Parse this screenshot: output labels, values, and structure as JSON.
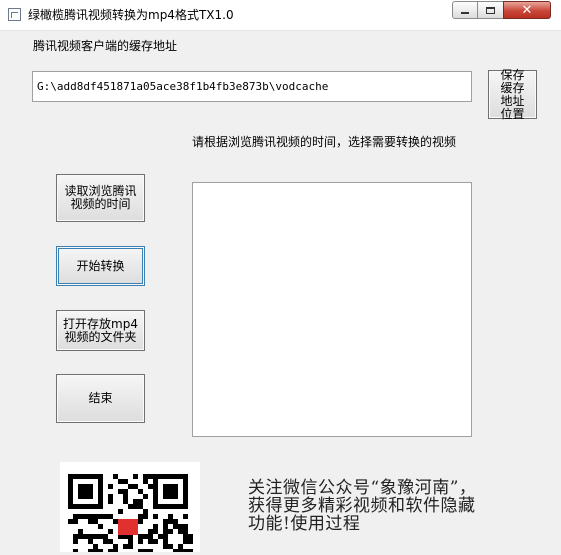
{
  "window": {
    "title": "绿橄榄腾讯视频转换为mp4格式TX1.0",
    "controls": {
      "minimize": "minimize-icon",
      "maximize": "maximize-icon",
      "close": "✕"
    }
  },
  "cache": {
    "label": "腾讯视频客户端的缓存地址",
    "path_value": "G:\\add8df451871a05ace38f1b4fb3e873b\\vodcache",
    "save_button": "保存缓存地址位置"
  },
  "instruction": "请根据浏览腾讯视频的时间，选择需要转换的视频",
  "actions": {
    "read_time": "读取浏览腾讯视频的时间",
    "start_convert": "开始转换",
    "open_folder": "打开存放mp4视频的文件夹",
    "finish": "结束"
  },
  "video_list": {
    "items": []
  },
  "promo": {
    "qr_code": "qr-code-image",
    "text": "关注微信公众号“象豫河南”，获得更多精彩视频和软件隐藏功能!使用过程"
  }
}
